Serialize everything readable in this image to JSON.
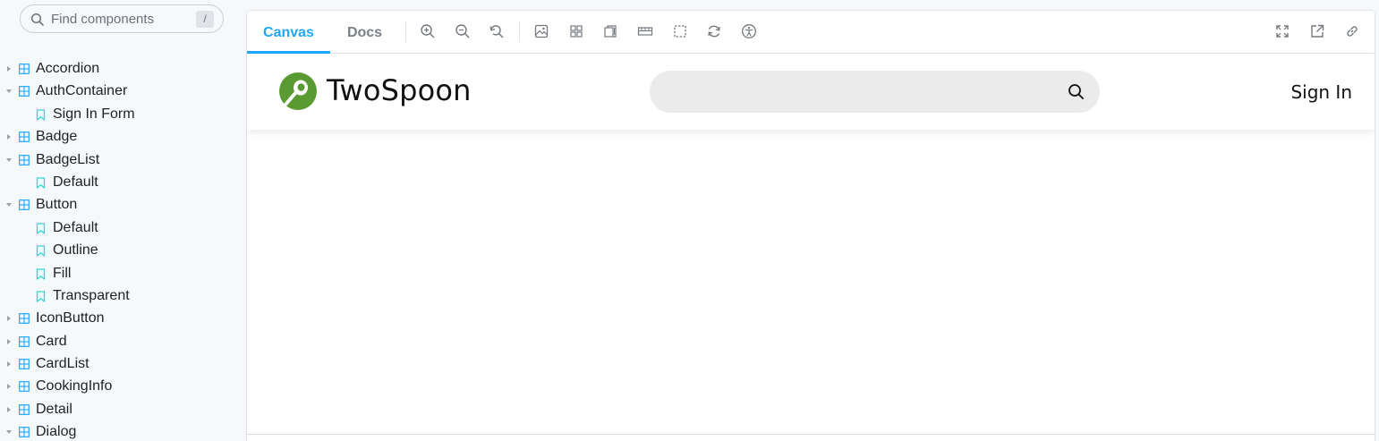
{
  "sidebar": {
    "search": {
      "placeholder": "Find components",
      "shortcut": "/"
    },
    "items": [
      {
        "type": "component",
        "label": "Accordion",
        "expanded": false
      },
      {
        "type": "component",
        "label": "AuthContainer",
        "expanded": true
      },
      {
        "type": "story",
        "label": "Sign In Form"
      },
      {
        "type": "component",
        "label": "Badge",
        "expanded": false
      },
      {
        "type": "component",
        "label": "BadgeList",
        "expanded": true
      },
      {
        "type": "story",
        "label": "Default"
      },
      {
        "type": "component",
        "label": "Button",
        "expanded": true
      },
      {
        "type": "story",
        "label": "Default"
      },
      {
        "type": "story",
        "label": "Outline"
      },
      {
        "type": "story",
        "label": "Fill"
      },
      {
        "type": "story",
        "label": "Transparent"
      },
      {
        "type": "component",
        "label": "IconButton",
        "expanded": false
      },
      {
        "type": "component",
        "label": "Card",
        "expanded": false
      },
      {
        "type": "component",
        "label": "CardList",
        "expanded": false
      },
      {
        "type": "component",
        "label": "CookingInfo",
        "expanded": false
      },
      {
        "type": "component",
        "label": "Detail",
        "expanded": false
      },
      {
        "type": "component",
        "label": "Dialog",
        "expanded": true
      }
    ]
  },
  "toolbar": {
    "tabs": [
      {
        "label": "Canvas",
        "active": true
      },
      {
        "label": "Docs",
        "active": false
      }
    ],
    "tools": [
      "zoom-in-icon",
      "zoom-out-icon",
      "zoom-reset-icon",
      "background-icon",
      "grid-icon",
      "viewport-icon",
      "measure-icon",
      "outline-icon",
      "remount-icon",
      "accessibility-icon"
    ],
    "right_tools": [
      "fullscreen-icon",
      "open-new-tab-icon",
      "copy-link-icon"
    ]
  },
  "preview": {
    "brand": "TwoSpoon",
    "search_value": "",
    "sign_in": "Sign In"
  },
  "colors": {
    "accent": "#1ea7fd",
    "brand_green": "#5a9a32",
    "sidebar_bg": "#f6f9fc",
    "component_icon": "#1ea7fd",
    "story_icon": "#37d5d3"
  }
}
